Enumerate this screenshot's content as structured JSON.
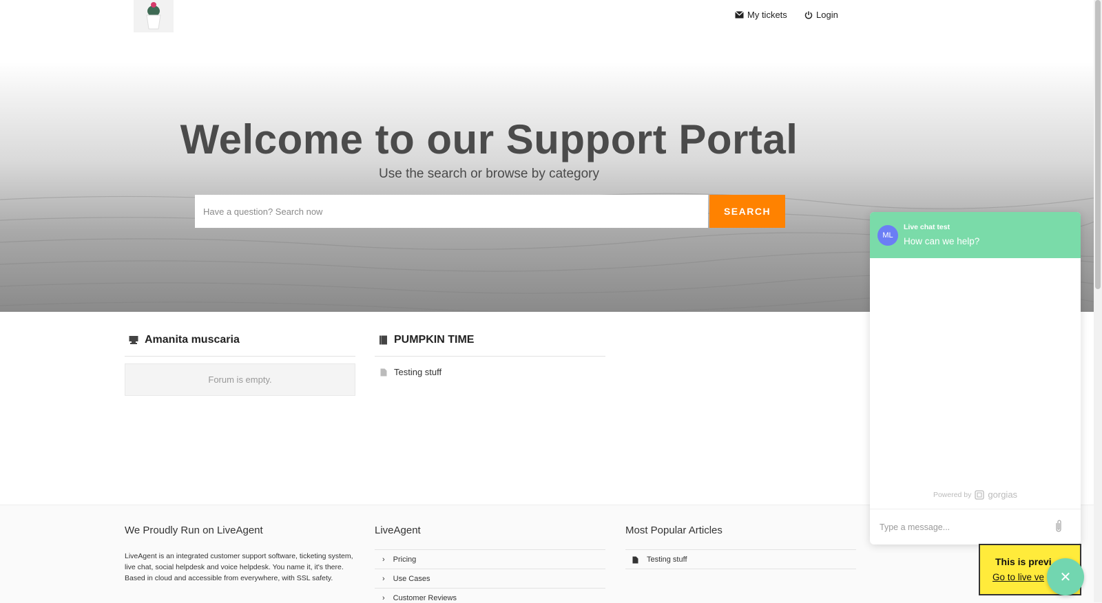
{
  "header": {
    "my_tickets": "My tickets",
    "login": "Login"
  },
  "hero": {
    "title": "Welcome to our Support Portal",
    "subtitle": "Use the search or browse by category",
    "search_placeholder": "Have a question? Search now",
    "search_button": "SEARCH"
  },
  "categories": [
    {
      "title": "Amanita muscaria",
      "icon": "forum-icon",
      "empty_text": "Forum is empty."
    },
    {
      "title": "PUMPKIN TIME",
      "icon": "book-icon",
      "articles": [
        "Testing stuff"
      ]
    }
  ],
  "footer": {
    "col1": {
      "title": "We Proudly Run on LiveAgent",
      "text": "LiveAgent is an integrated customer support software, ticketing system, live chat, social helpdesk and voice helpdesk. You name it, it's there. Based in cloud and accessible from everywhere, with SSL safety."
    },
    "col2": {
      "title": "LiveAgent",
      "links": [
        "Pricing",
        "Use Cases",
        "Customer Reviews"
      ]
    },
    "col3": {
      "title": "Most Popular Articles",
      "links": [
        "Testing stuff"
      ]
    }
  },
  "chat": {
    "avatar": "ML",
    "title": "Live chat test",
    "question": "How can we help?",
    "powered_by": "Powered by",
    "brand": "gorgias",
    "input_placeholder": "Type a message..."
  },
  "preview": {
    "title": "This is previ",
    "link": "Go to live ve"
  },
  "colors": {
    "accent_orange": "#ff8200",
    "chat_green": "#7adba9",
    "avatar_purple": "#6b7ef5",
    "preview_yellow": "#ffeb3b"
  }
}
